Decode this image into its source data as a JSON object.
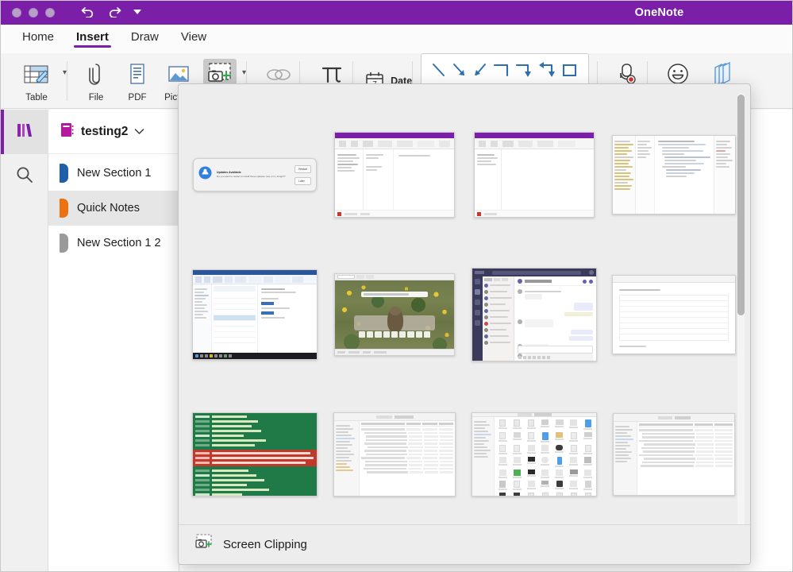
{
  "window": {
    "app_title": "OneNote",
    "titlebar_color": "#7b1fa8",
    "traffic_lights": [
      "close",
      "minimize",
      "zoom"
    ],
    "undo_label": "Undo",
    "redo_label": "Redo",
    "customize_label": "Customize Toolbar"
  },
  "tabs": [
    {
      "label": "Home",
      "active": false
    },
    {
      "label": "Insert",
      "active": true
    },
    {
      "label": "Draw",
      "active": false
    },
    {
      "label": "View",
      "active": false
    }
  ],
  "ribbon": {
    "table": {
      "label": "Table",
      "icon": "table-icon"
    },
    "file": {
      "label": "File",
      "icon": "paperclip-icon"
    },
    "pdf": {
      "label": "PDF",
      "icon": "pdf-document-icon"
    },
    "picture": {
      "label": "Picture",
      "icon": "picture-icon"
    },
    "screenshot": {
      "label": "S",
      "full_label": "Screenshot",
      "icon": "camera-plus-icon",
      "selected": true
    },
    "link": {
      "label": "",
      "icon": "link-chain-icon"
    },
    "equation": {
      "label": "",
      "icon": "pi-equation-icon"
    },
    "date": {
      "label": "Date",
      "icon": "calendar-icon",
      "calendar_day": "7"
    },
    "shapes": [
      "line-shape",
      "arrow-down-right-shape",
      "arrow-up-left-shape",
      "elbow-connector-shape",
      "elbow-arrow-shape",
      "elbow-double-arrow-shape",
      "rectangle-shape"
    ],
    "audio": {
      "label": "",
      "icon": "audio-record-icon"
    },
    "emoji": {
      "label": "",
      "icon": "smiley-face-icon"
    },
    "researcher": {
      "label": "esearcher",
      "full_label": "Researcher",
      "icon": "books-icon"
    }
  },
  "rail": {
    "notebooks": {
      "name": "notebooks-icon",
      "active": true
    },
    "search": {
      "name": "search-icon",
      "active": false
    }
  },
  "notebook": {
    "name": "testing2",
    "icon": "notebook-icon",
    "icon_color": "#b5179e",
    "chevron": "chevron-down-icon",
    "sections": [
      {
        "label": "New Section 1",
        "color": "#1f5fa9",
        "active": false
      },
      {
        "label": "Quick Notes",
        "color": "#ec7211",
        "active": true
      },
      {
        "label": "New Section 1 2",
        "color": "#9a9a9a",
        "active": false
      }
    ]
  },
  "screenshot_panel": {
    "footer_label": "Screen Clipping",
    "footer_icon": "camera-plus-icon",
    "scrollbar": {
      "name": "vertical-scrollbar",
      "thumb_position_pct": 0
    },
    "thumbnails": [
      {
        "id": "updates-available-dialog",
        "kind": "dialog",
        "dialog": {
          "title": "Updates Available",
          "body": "Do you want to restart to install these updates now or try tonight?",
          "primary": "Restart",
          "secondary": "Later",
          "icon": "updates-icon"
        }
      },
      {
        "id": "onenote-window-1",
        "kind": "onenote"
      },
      {
        "id": "onenote-window-2",
        "kind": "onenote"
      },
      {
        "id": "code-editor-window",
        "kind": "code"
      },
      {
        "id": "outlook-mail-window",
        "kind": "mail"
      },
      {
        "id": "browser-nature-photo",
        "kind": "photo"
      },
      {
        "id": "teams-chat-window",
        "kind": "teams"
      },
      {
        "id": "document-window",
        "kind": "doc"
      },
      {
        "id": "green-terminal-window",
        "kind": "terminal"
      },
      {
        "id": "finder-list-window",
        "kind": "finder-list"
      },
      {
        "id": "finder-icons-window",
        "kind": "finder-icons"
      },
      {
        "id": "finder-list-window-2",
        "kind": "finder-list2"
      }
    ]
  }
}
